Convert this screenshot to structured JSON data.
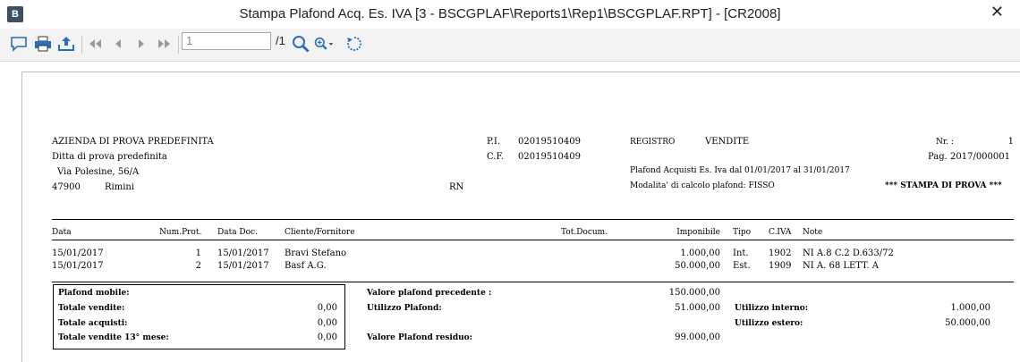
{
  "window": {
    "title": "Stampa Plafond Acq. Es. IVA [3 - BSCGPLAF\\Reports1\\Rep1\\BSCGPLAF.RPT] - [CR2008]",
    "close": "✕",
    "app_icon": "B"
  },
  "toolbar": {
    "page_value": "1",
    "page_total": "/1",
    "icons": [
      "comment-icon",
      "print-icon",
      "export-icon",
      "first-page-icon",
      "prev-page-icon",
      "next-page-icon",
      "last-page-icon",
      "search-icon",
      "zoom-icon",
      "refresh-icon"
    ]
  },
  "report": {
    "header": {
      "company": "AZIENDA DI PROVA PREDEFINITA",
      "company_sub": "Ditta di prova predefinita",
      "address": "Via Polesine, 56/A",
      "cap": "47900",
      "city": "Rimini",
      "province": "RN",
      "pi_label": "P.I.",
      "pi_value": "02019510409",
      "cf_label": "C.F.",
      "cf_value": "02019510409",
      "registro_label": "REGISTRO",
      "registro_value": "VENDITE",
      "nr_label": "Nr. :",
      "nr_value": "1",
      "pag": "Pag. 2017/000001",
      "plafond_period": "Plafond Acquisti Es. Iva dal 01/01/2017 al 31/01/2017",
      "modalita": "Modalita' di calcolo plafond: FISSO",
      "stampa_prova": "*** STAMPA DI PROVA ***"
    },
    "columns": {
      "data": "Data",
      "num_prot": "Num.Prot.",
      "data_doc": "Data Doc.",
      "cliente": "Cliente/Fornitore",
      "tot_docum": "Tot.Docum.",
      "imponibile": "Imponibile",
      "tipo": "Tipo",
      "civa": "C.IVA",
      "note": "Note"
    },
    "rows": [
      {
        "data": "15/01/2017",
        "num_prot": "1",
        "data_doc": "15/01/2017",
        "cliente": "Bravi Stefano",
        "tot_docum": "",
        "imponibile": "1.000,00",
        "tipo": "Int.",
        "civa": "1902",
        "note": "NI A.8 C.2 D.633/72"
      },
      {
        "data": "15/01/2017",
        "num_prot": "2",
        "data_doc": "15/01/2017",
        "cliente": "Basf A.G.",
        "tot_docum": "",
        "imponibile": "50.000,00",
        "tipo": "Est.",
        "civa": "1909",
        "note": "NI A. 68 LETT. A"
      }
    ],
    "summary": {
      "plafond_mobile_label": "Plafond mobile:",
      "totale_vendite_label": "Totale vendite:",
      "totale_vendite_value": "0,00",
      "totale_acquisti_label": "Totale acquisti:",
      "totale_acquisti_value": "0,00",
      "totale_13_label": "Totale vendite 13° mese:",
      "totale_13_value": "0,00",
      "valore_precedente_label": "Valore plafond precedente :",
      "valore_precedente_value": "150.000,00",
      "utilizzo_plafond_label": "Utilizzo Plafond:",
      "utilizzo_plafond_value": "51.000,00",
      "valore_residuo_label": "Valore Plafond residuo:",
      "valore_residuo_value": "99.000,00",
      "utilizzo_interno_label": "Utilizzo interno:",
      "utilizzo_interno_value": "1.000,00",
      "utilizzo_estero_label": "Utilizzo estero:",
      "utilizzo_estero_value": "50.000,00"
    }
  }
}
